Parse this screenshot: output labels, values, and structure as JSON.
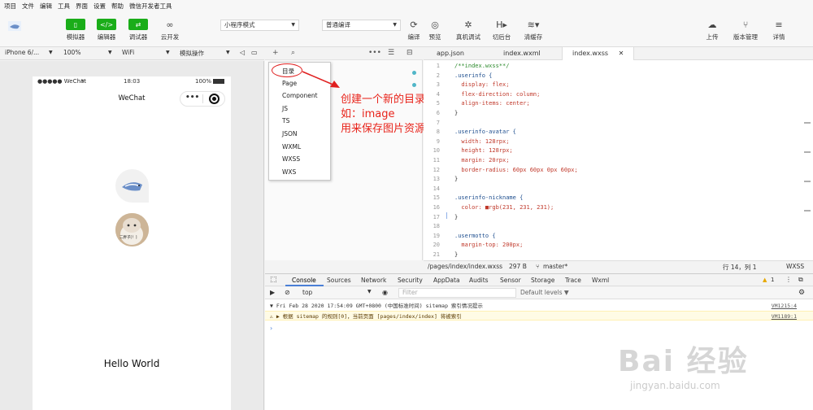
{
  "menubar": [
    "项目",
    "文件",
    "编辑",
    "工具",
    "界面",
    "设置",
    "帮助",
    "微信开发者工具"
  ],
  "toolbar": {
    "left_buttons": [
      {
        "label": "模拟器",
        "icon": "phone-icon"
      },
      {
        "label": "编辑器",
        "icon": "code-icon"
      },
      {
        "label": "调试器",
        "icon": "debug-icon"
      },
      {
        "label": "云开发",
        "icon": "cloud-dev-icon"
      }
    ],
    "mode_select": "小程序模式",
    "compile_select": "普通编译",
    "center_buttons": [
      {
        "label": "编译",
        "icon": "refresh-icon"
      },
      {
        "label": "预览",
        "icon": "eye-icon"
      },
      {
        "label": "真机调试",
        "icon": "bug-icon"
      },
      {
        "label": "切后台",
        "icon": "switch-icon"
      },
      {
        "label": "清缓存",
        "icon": "layers-icon"
      }
    ],
    "right_buttons": [
      {
        "label": "上传",
        "icon": "upload-icon"
      },
      {
        "label": "版本管理",
        "icon": "branch-icon"
      },
      {
        "label": "详情",
        "icon": "menu-icon"
      }
    ]
  },
  "devicebar": {
    "device": "iPhone 6/...",
    "zoom": "100%",
    "network": "WiFi",
    "operation": "模拟操作"
  },
  "phone": {
    "carrier": "●●●●● WeChat",
    "time": "18:03",
    "battery": "100%",
    "nav_title": "WeChat",
    "capsule_dots": "•••",
    "avatar_caption": "二胖子[！]",
    "hello": "Hello World"
  },
  "context_menu": [
    "目录",
    "Page",
    "Component",
    "JS",
    "TS",
    "JSON",
    "WXML",
    "WXSS",
    "WXS"
  ],
  "tree_partial": "son",
  "annotation": {
    "line1": "创建一个新的目录",
    "line2": "如：image",
    "line3": "用来保存图片资源"
  },
  "editor_tabs": [
    {
      "label": "app.json",
      "active": false
    },
    {
      "label": "index.wxml",
      "active": false
    },
    {
      "label": "index.wxss",
      "active": true
    }
  ],
  "code_lines": [
    {
      "n": "1",
      "t": "/**index.wxss**/",
      "k": "cmt"
    },
    {
      "n": "2",
      "t": ".userinfo {",
      "k": "sel-c"
    },
    {
      "n": "3",
      "t": "  display: flex;",
      "k": "prop"
    },
    {
      "n": "4",
      "t": "  flex-direction: column;",
      "k": "prop"
    },
    {
      "n": "5",
      "t": "  align-items: center;",
      "k": "prop"
    },
    {
      "n": "6",
      "t": "}",
      "k": "pun"
    },
    {
      "n": "7",
      "t": "",
      "k": "pun"
    },
    {
      "n": "8",
      "t": ".userinfo-avatar {",
      "k": "sel-c"
    },
    {
      "n": "9",
      "t": "  width: 128rpx;",
      "k": "prop"
    },
    {
      "n": "10",
      "t": "  height: 128rpx;",
      "k": "prop"
    },
    {
      "n": "11",
      "t": "  margin: 20rpx;",
      "k": "prop"
    },
    {
      "n": "12",
      "t": "  border-radius: 60px 60px 0px 60px;",
      "k": "prop"
    },
    {
      "n": "13",
      "t": "}",
      "k": "pun"
    },
    {
      "n": "14",
      "t": "",
      "k": "pun"
    },
    {
      "n": "15",
      "t": ".userinfo-nickname {",
      "k": "sel-c"
    },
    {
      "n": "16",
      "t": "  color: ■rgb(231, 231, 231);",
      "k": "prop"
    },
    {
      "n": "17",
      "t": "}",
      "k": "pun"
    },
    {
      "n": "18",
      "t": "",
      "k": "pun"
    },
    {
      "n": "19",
      "t": ".usermotto {",
      "k": "sel-c"
    },
    {
      "n": "20",
      "t": "  margin-top: 200px;",
      "k": "prop"
    },
    {
      "n": "21",
      "t": "}",
      "k": "pun"
    }
  ],
  "editor_status": {
    "path": "/pages/index/index.wxss",
    "size": "297 B",
    "branch": "master*",
    "pos": "行 14，列 1",
    "lang": "WXSS"
  },
  "devtools_tabs": [
    "Console",
    "Sources",
    "Network",
    "Security",
    "AppData",
    "Audits",
    "Sensor",
    "Storage",
    "Trace",
    "Wxml"
  ],
  "devtools_warn_count": "1",
  "console_filter": {
    "context": "top",
    "filter_placeholder": "Filter",
    "levels": "Default levels ▼"
  },
  "console_lines": [
    {
      "text": "▼ Fri Feb 28 2020 17:54:09 GMT+0800 (中国标准时间) sitemap 索引情况提示",
      "src": "VM1215:4",
      "warn": false
    },
    {
      "text": "  ⚠ ▶ 根据 sitemap 的规则[0]，当前页面 [pages/index/index] 将被索引",
      "src": "VM1189:1",
      "warn": true
    }
  ],
  "watermark": {
    "main": "Bai  经验",
    "sub": "jingyan.baidu.com"
  },
  "colors": {
    "accent_green": "#1aad19",
    "annotation_red": "#e8241b",
    "tab_underline": "#4a7fd6"
  }
}
